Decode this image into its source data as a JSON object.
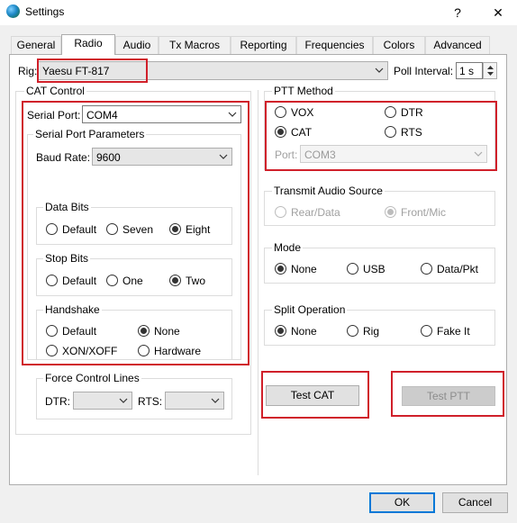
{
  "window": {
    "title": "Settings",
    "help_glyph": "?",
    "close_glyph": "✕"
  },
  "tabs": [
    {
      "label": "General"
    },
    {
      "label": "Radio"
    },
    {
      "label": "Audio"
    },
    {
      "label": "Tx Macros"
    },
    {
      "label": "Reporting"
    },
    {
      "label": "Frequencies"
    },
    {
      "label": "Colors"
    },
    {
      "label": "Advanced"
    }
  ],
  "active_tab": "Radio",
  "rig": {
    "label": "Rig:",
    "value": "Yaesu FT-817"
  },
  "poll": {
    "label": "Poll Interval:",
    "value": "1 s"
  },
  "cat": {
    "title": "CAT Control",
    "serial_port_label": "Serial Port:",
    "serial_port_value": "COM4",
    "params_title": "Serial Port Parameters",
    "baud_label": "Baud Rate:",
    "baud_value": "9600",
    "data_bits": {
      "title": "Data Bits",
      "options": [
        "Default",
        "Seven",
        "Eight"
      ],
      "selected": "Eight"
    },
    "stop_bits": {
      "title": "Stop Bits",
      "options": [
        "Default",
        "One",
        "Two"
      ],
      "selected": "Two"
    },
    "handshake": {
      "title": "Handshake",
      "options": [
        "Default",
        "None",
        "XON/XOFF",
        "Hardware"
      ],
      "selected": "None"
    },
    "force": {
      "title": "Force Control Lines",
      "dtr_label": "DTR:",
      "rts_label": "RTS:"
    }
  },
  "ptt": {
    "title": "PTT Method",
    "options": [
      "VOX",
      "DTR",
      "CAT",
      "RTS"
    ],
    "selected": "CAT",
    "port_label": "Port:",
    "port_value": "COM3"
  },
  "tx_audio": {
    "title": "Transmit Audio Source",
    "options": [
      "Rear/Data",
      "Front/Mic"
    ],
    "selected": "Front/Mic"
  },
  "mode": {
    "title": "Mode",
    "options": [
      "None",
      "USB",
      "Data/Pkt"
    ],
    "selected": "None"
  },
  "split": {
    "title": "Split Operation",
    "options": [
      "None",
      "Rig",
      "Fake It"
    ],
    "selected": "None"
  },
  "buttons": {
    "test_cat": "Test CAT",
    "test_ptt": "Test PTT",
    "ok": "OK",
    "cancel": "Cancel"
  },
  "colors": {
    "highlight": "#d0202a",
    "focus_border": "#0078d7"
  }
}
